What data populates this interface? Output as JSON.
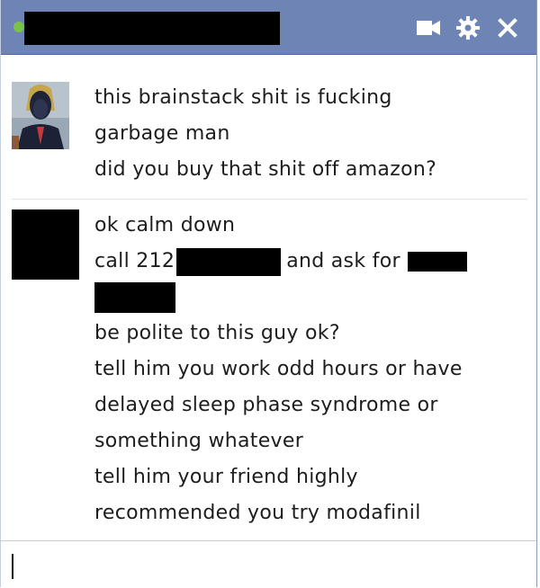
{
  "titlebar": {
    "icons": [
      "video-camera-icon",
      "gear-icon",
      "close-icon"
    ],
    "status_color": "#7bc248",
    "bar_color": "#6d84b4"
  },
  "messages": [
    {
      "sender": "friend",
      "lines": [
        "this brainstack shit is fucking",
        "garbage man",
        "did you buy that shit off amazon?"
      ]
    },
    {
      "sender": "me",
      "lines": [
        "ok calm down",
        "call 212",
        "and ask for",
        "be polite to this guy ok?",
        "tell him you work odd hours or have",
        "delayed sleep phase syndrome or",
        "something whatever",
        "tell him your friend highly",
        "recommended you try modafinil"
      ]
    }
  ],
  "input": {
    "value": ""
  }
}
